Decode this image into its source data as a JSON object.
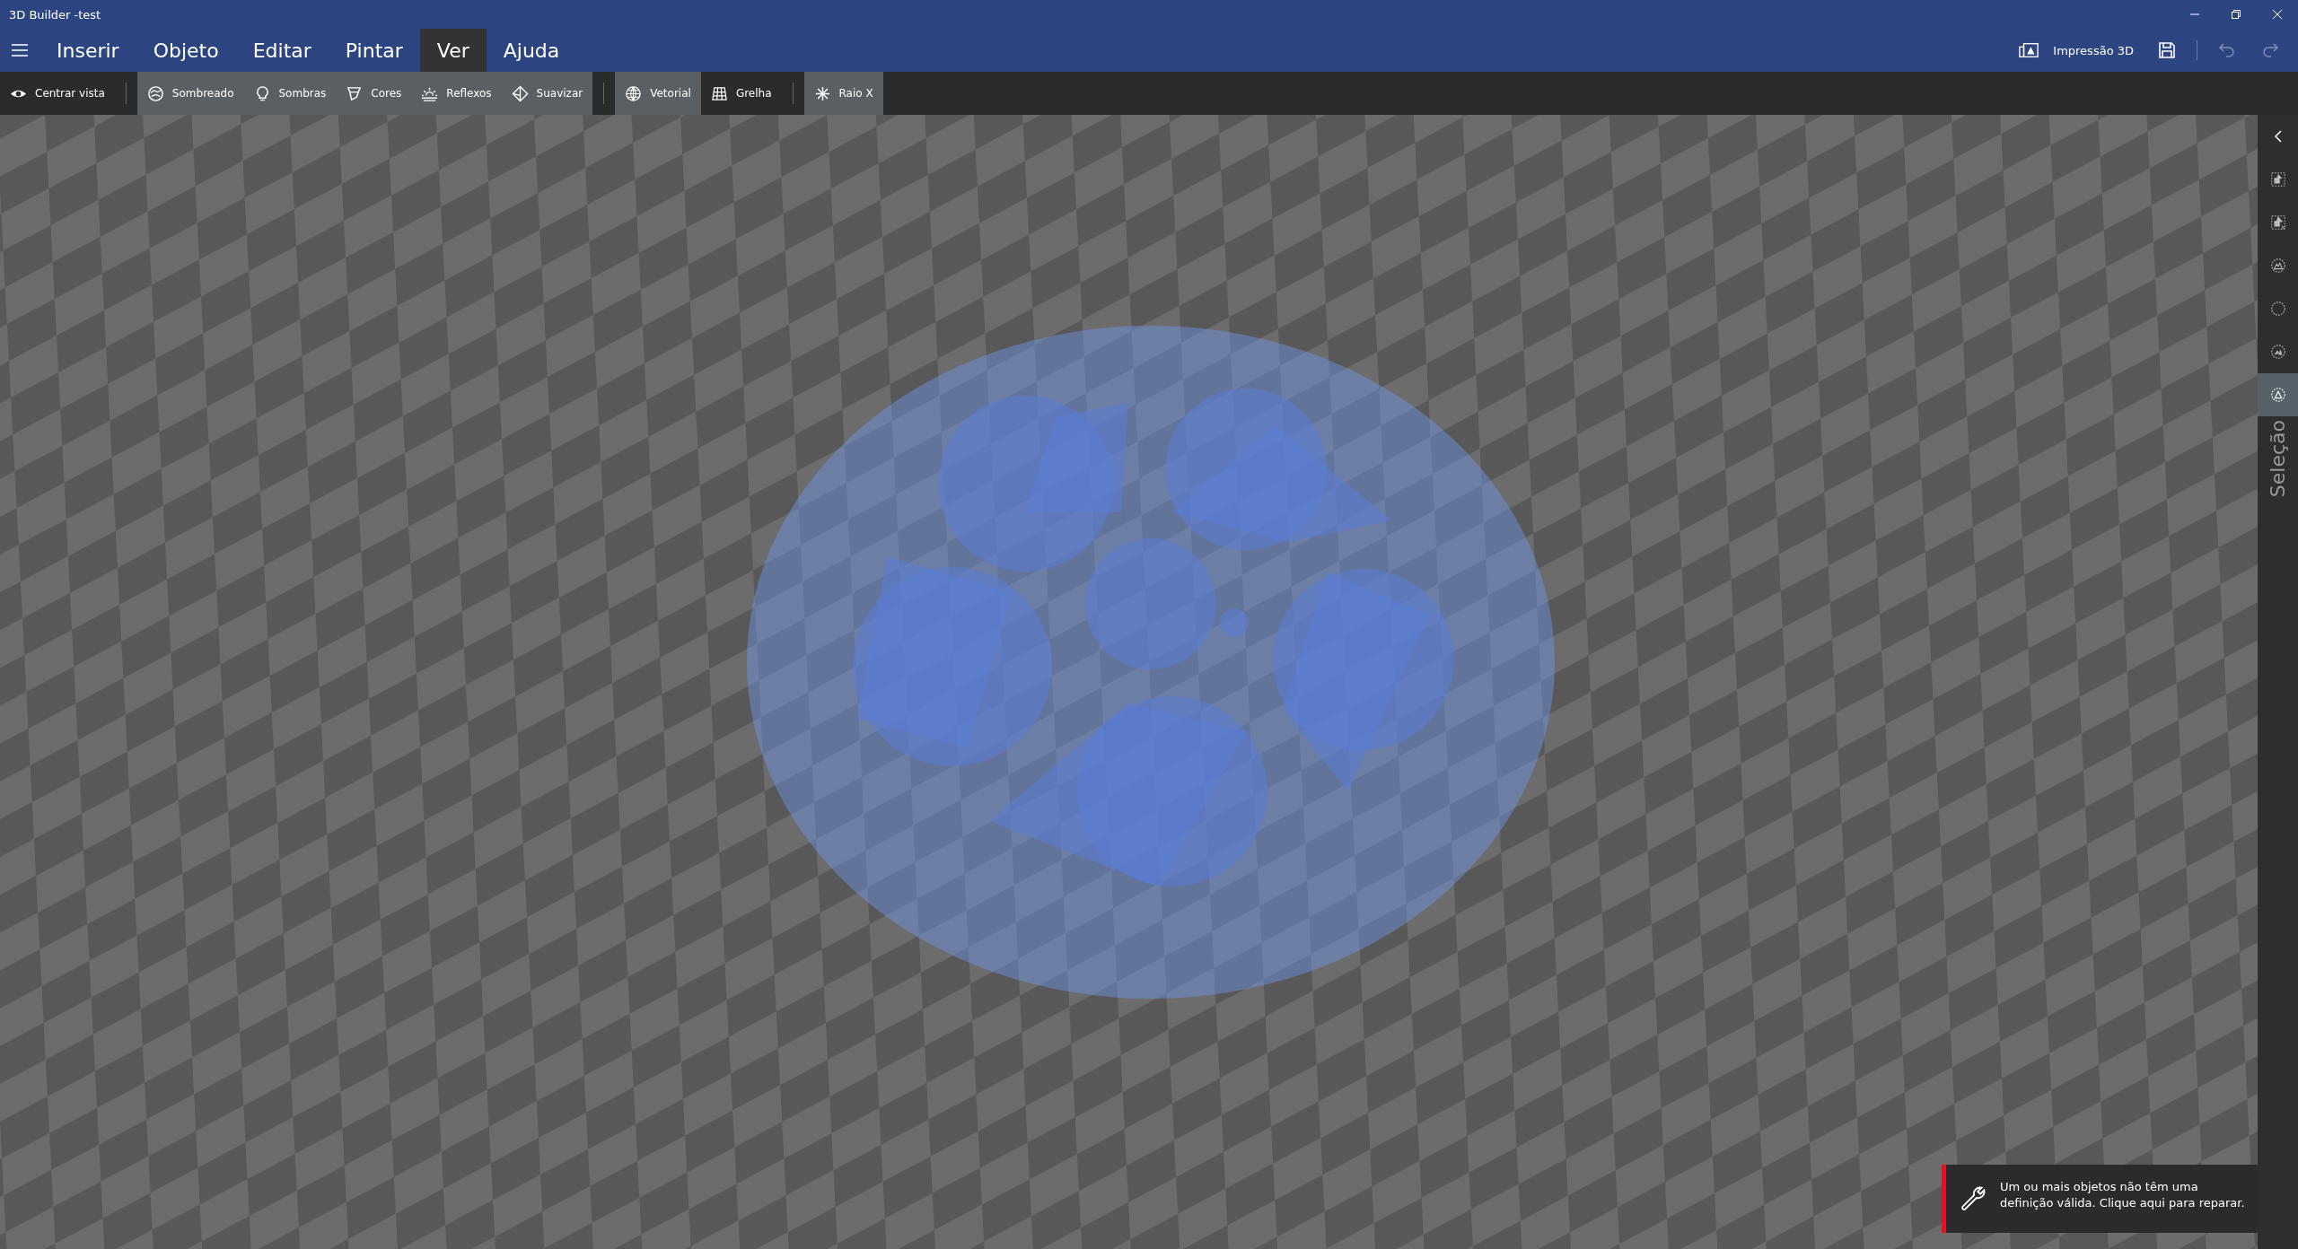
{
  "window": {
    "title": "3D Builder -test"
  },
  "menu": {
    "items": [
      {
        "label": "Inserir",
        "selected": false
      },
      {
        "label": "Objeto",
        "selected": false
      },
      {
        "label": "Editar",
        "selected": false
      },
      {
        "label": "Pintar",
        "selected": false
      },
      {
        "label": "Ver",
        "selected": true
      },
      {
        "label": "Ajuda",
        "selected": false
      }
    ]
  },
  "quick_actions": [
    {
      "kind": "print",
      "label": "Impressão 3D",
      "disabled": false
    },
    {
      "kind": "save",
      "disabled": false
    },
    {
      "kind": "undo",
      "disabled": true
    },
    {
      "kind": "redo",
      "disabled": true
    }
  ],
  "toolbar": {
    "groups": [
      [
        {
          "kind": "eye",
          "label": "Centrar vista",
          "on": false
        }
      ],
      [
        {
          "kind": "shaded",
          "label": "Sombreado",
          "on": true
        },
        {
          "kind": "bulb",
          "label": "Sombras",
          "on": true
        },
        {
          "kind": "paint",
          "label": "Cores",
          "on": true
        },
        {
          "kind": "sunrise",
          "label": "Reflexos",
          "on": true
        },
        {
          "kind": "diamond",
          "label": "Suavizar",
          "on": true
        }
      ],
      [
        {
          "kind": "globe",
          "label": "Vetorial",
          "on": true
        },
        {
          "kind": "grid",
          "label": "Grelha",
          "on": false
        }
      ],
      [
        {
          "kind": "asterisk",
          "label": "Raio X",
          "on": true
        }
      ]
    ]
  },
  "side_panel": {
    "label": "Seleção",
    "items": [
      {
        "kind": "select-all",
        "selected": false
      },
      {
        "kind": "deselect",
        "selected": false
      },
      {
        "kind": "select-objects",
        "selected": false
      },
      {
        "kind": "empty",
        "selected": false
      },
      {
        "kind": "select-parts",
        "selected": false
      },
      {
        "kind": "select-mesh",
        "selected": true
      }
    ]
  },
  "notification": {
    "text": "Um ou mais objetos não têm uma definição válida. Clique aqui para reparar."
  }
}
